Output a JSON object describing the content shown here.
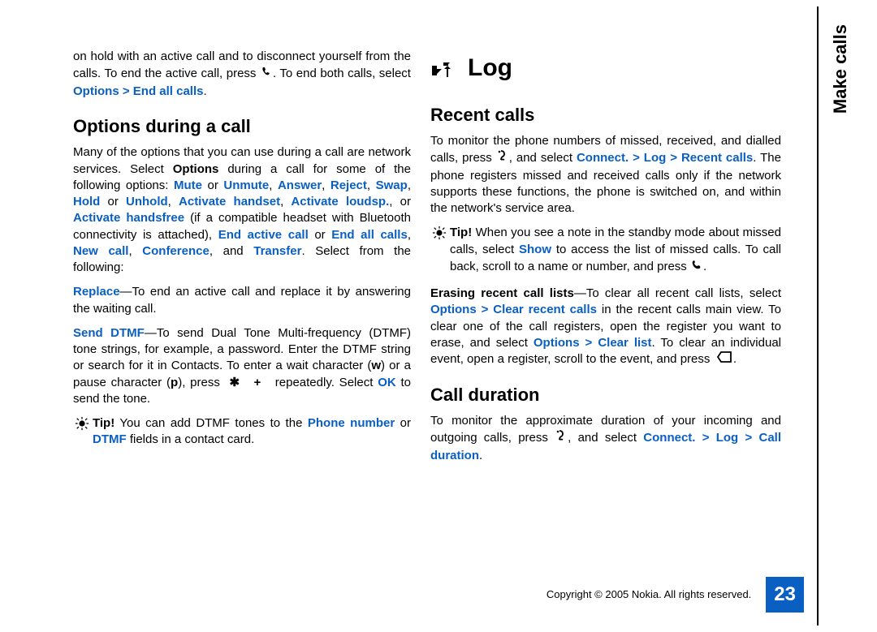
{
  "sidebar_title": "Make calls",
  "page_number": "23",
  "copyright": "Copyright © 2005 Nokia. All rights reserved.",
  "col1": {
    "p1_a": "on hold with an active call and to disconnect yourself from the calls. To end the active call, press ",
    "p1_b": ". To end both calls, select ",
    "p1_opt": "Options",
    "p1_gt": " > ",
    "p1_end": "End all calls",
    "p1_dot": ".",
    "h2_options": "Options during a call",
    "p2_a": "Many of the options that you can use during a call are network services. Select ",
    "p2_options": "Options",
    "p2_b": " during a call for some of the following options: ",
    "p2_mute": "Mute",
    "p2_or1": " or ",
    "p2_unmute": "Unmute",
    "p2_c1": ", ",
    "p2_answer": "Answer",
    "p2_c2": ", ",
    "p2_reject": "Reject",
    "p2_c3": ", ",
    "p2_swap": "Swap",
    "p2_c4": ", ",
    "p2_hold": "Hold",
    "p2_or2": " or ",
    "p2_unhold": "Unhold",
    "p2_c5": ", ",
    "p2_ah": "Activate handset",
    "p2_c6": ", ",
    "p2_al": "Activate loudsp.",
    "p2_c7": ", or ",
    "p2_ahf": "Activate handsfree",
    "p2_d": " (if a compatible headset with Bluetooth connectivity is attached), ",
    "p2_eac": "End active call",
    "p2_or3": " or ",
    "p2_eall": "End all calls",
    "p2_c8": ", ",
    "p2_nc": "New call",
    "p2_c9": ", ",
    "p2_conf": "Conference",
    "p2_c10": ", and ",
    "p2_tr": "Transfer",
    "p2_e": ". Select from the following:",
    "p3_replace": "Replace",
    "p3_a": "—To end an active call and replace it by answering the waiting call.",
    "p4_send": "Send DTMF",
    "p4_a": "—To send Dual Tone Multi-frequency (DTMF) tone strings, for example, a password. Enter the DTMF string or search for it in Contacts. To enter a wait character (",
    "p4_w": "w",
    "p4_b": ") or a pause character (",
    "p4_p": "p",
    "p4_c": "), press ",
    "p4_star": "✱",
    "p4_plus": "+",
    "p4_d": " repeatedly. Select ",
    "p4_ok": "OK",
    "p4_e": " to send the tone.",
    "tip1_label": "Tip!",
    "tip1_a": " You can add DTMF tones to the ",
    "tip1_pn": "Phone number",
    "tip1_b": " or ",
    "tip1_dtmf": "DTMF",
    "tip1_c": " fields in a contact card."
  },
  "col2": {
    "h1_log": "Log",
    "h2_recent": "Recent calls",
    "p5_a": "To monitor the phone numbers of missed, received, and dialled calls, press ",
    "p5_b": ", and select ",
    "p5_connect": "Connect.",
    "p5_gt1": " > ",
    "p5_log": "Log",
    "p5_gt2": " > ",
    "p5_rc": "Recent calls",
    "p5_c": ". The phone registers missed and received calls only if the network supports these functions, the phone is switched on, and within the network's service area.",
    "tip2_label": "Tip!",
    "tip2_a": " When you see a note in the standby mode about missed calls, select ",
    "tip2_show": "Show",
    "tip2_b": " to access the list of missed calls. To call back, scroll to a name or number, and press ",
    "tip2_c": ".",
    "p6_erc": "Erasing recent call lists",
    "p6_a": "—To clear all recent call lists, select ",
    "p6_opt1": "Options",
    "p6_gt1": " > ",
    "p6_crc": "Clear recent calls",
    "p6_b": " in the recent calls main view. To clear one of the call registers, open the register you want to erase, and select ",
    "p6_opt2": "Options",
    "p6_gt2": " > ",
    "p6_cl": "Clear list",
    "p6_c": ". To clear an individual event, open a register, scroll to the event, and press ",
    "p6_d": ".",
    "h2_cd": "Call duration",
    "p7_a": "To monitor the approximate duration of your incoming and outgoing calls, press ",
    "p7_b": ", and select ",
    "p7_connect": "Connect.",
    "p7_gt1": " > ",
    "p7_log": "Log",
    "p7_gt2": " > ",
    "p7_cd": "Call duration",
    "p7_c": "."
  }
}
